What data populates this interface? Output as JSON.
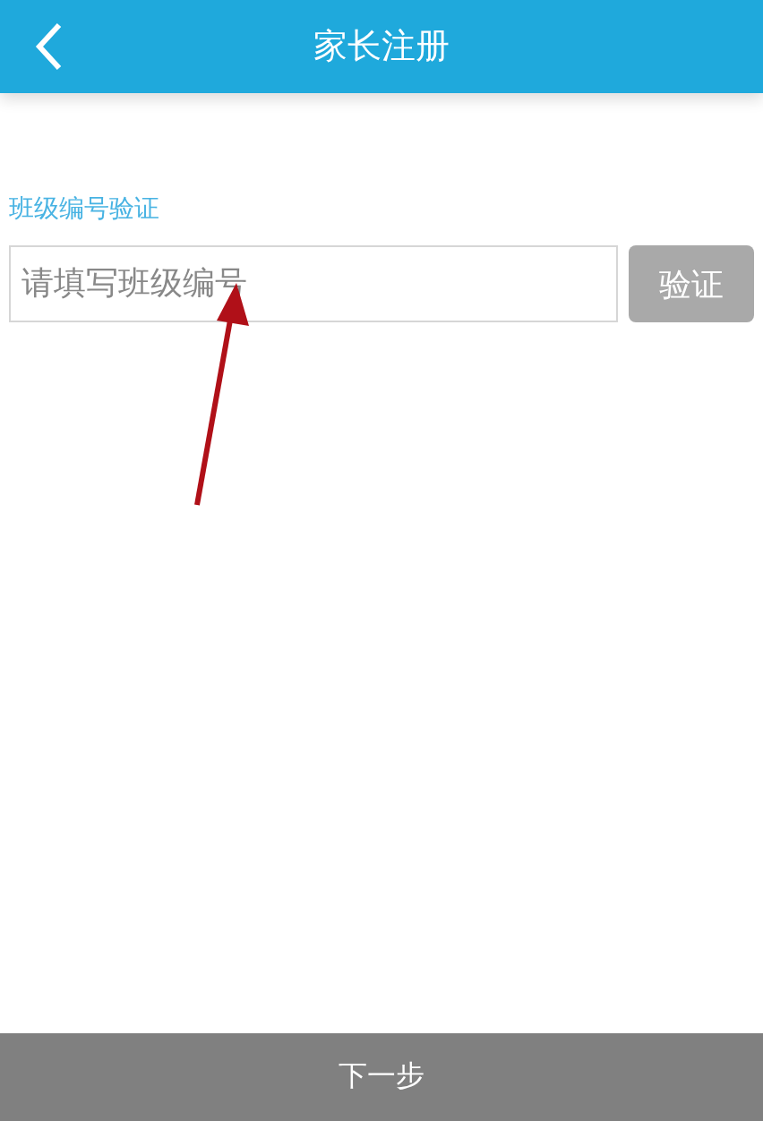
{
  "header": {
    "title": "家长注册"
  },
  "verify": {
    "label": "班级编号验证",
    "field": {
      "placeholder": "请填写班级编号"
    },
    "button": {
      "label": "验证",
      "disabled": true
    }
  },
  "footer": {
    "label": "下一步"
  }
}
